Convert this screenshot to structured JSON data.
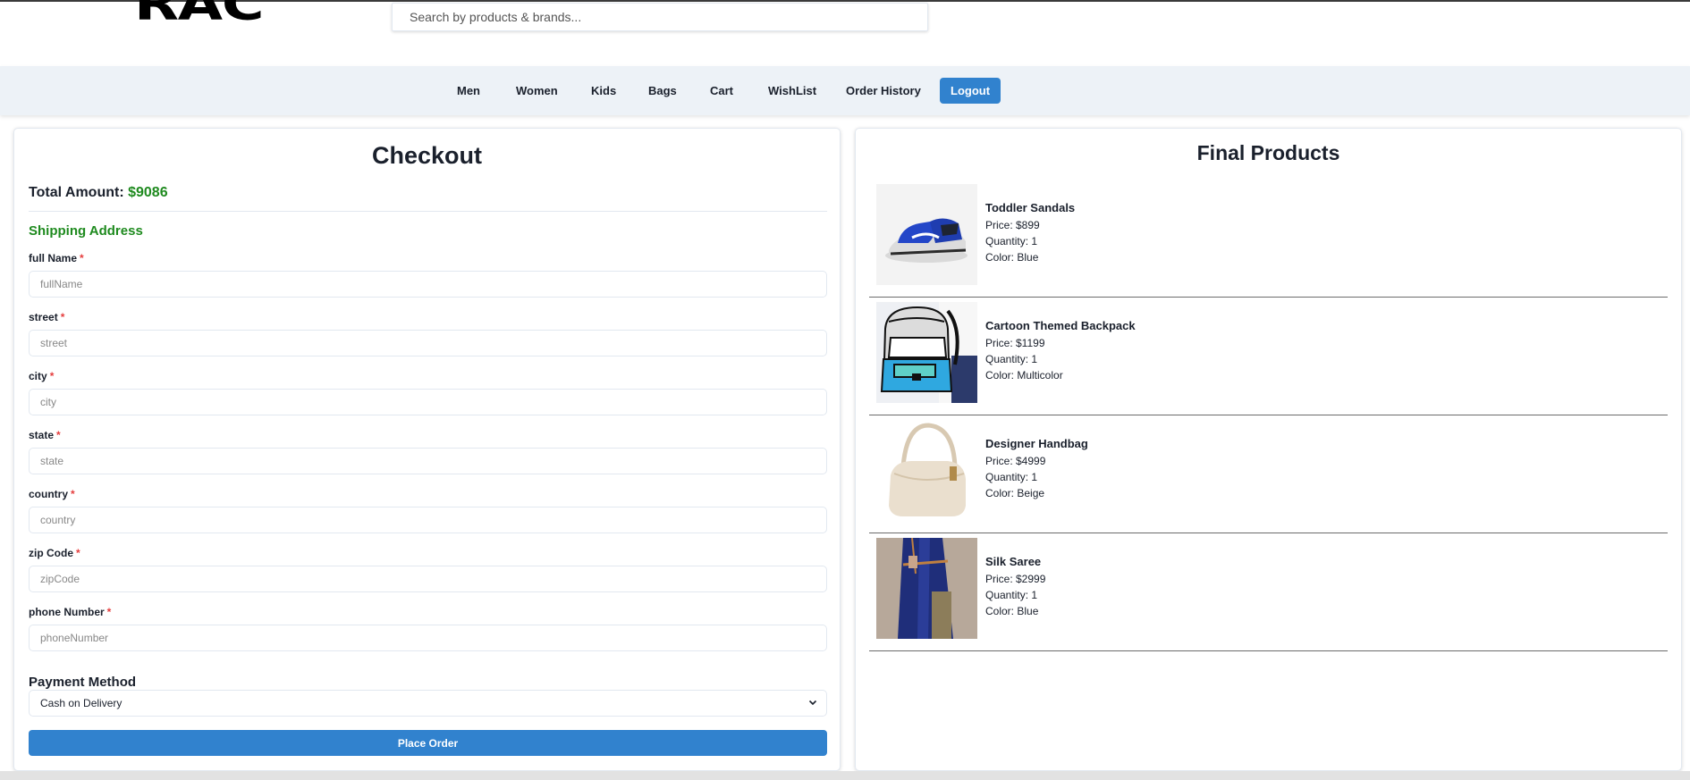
{
  "header": {
    "logo": "RACK",
    "search_placeholder": "Search by products & brands..."
  },
  "nav": {
    "items": [
      "Men",
      "Women",
      "Kids",
      "Bags",
      "Cart",
      "WishList",
      "Order History"
    ],
    "logout": "Logout"
  },
  "checkout": {
    "title": "Checkout",
    "total_label": "Total Amount:",
    "total_value": "$9086",
    "shipping_title": "Shipping Address",
    "fields": [
      {
        "label": "full Name",
        "placeholder": "fullName"
      },
      {
        "label": "street",
        "placeholder": "street"
      },
      {
        "label": "city",
        "placeholder": "city"
      },
      {
        "label": "state",
        "placeholder": "state"
      },
      {
        "label": "country",
        "placeholder": "country"
      },
      {
        "label": "zip Code",
        "placeholder": "zipCode"
      },
      {
        "label": "phone Number",
        "placeholder": "phoneNumber"
      }
    ],
    "required_marker": "*",
    "payment_title": "Payment Method",
    "payment_selected": "Cash on Delivery",
    "place_order": "Place Order"
  },
  "final_products": {
    "title": "Final Products",
    "items": [
      {
        "name": "Toddler Sandals",
        "price": "Price: $899",
        "quantity": "Quantity: 1",
        "color": "Color: Blue"
      },
      {
        "name": "Cartoon Themed Backpack",
        "price": "Price: $1199",
        "quantity": "Quantity: 1",
        "color": "Color: Multicolor"
      },
      {
        "name": "Designer Handbag",
        "price": "Price: $4999",
        "quantity": "Quantity: 1",
        "color": "Color: Beige"
      },
      {
        "name": "Silk Saree",
        "price": "Price: $2999",
        "quantity": "Quantity: 1",
        "color": "Color: Blue"
      }
    ]
  },
  "colors": {
    "accent": "#3182ce",
    "success": "#1e8a1e",
    "required": "#e53e3e",
    "nav_bg": "#edf2f7"
  }
}
